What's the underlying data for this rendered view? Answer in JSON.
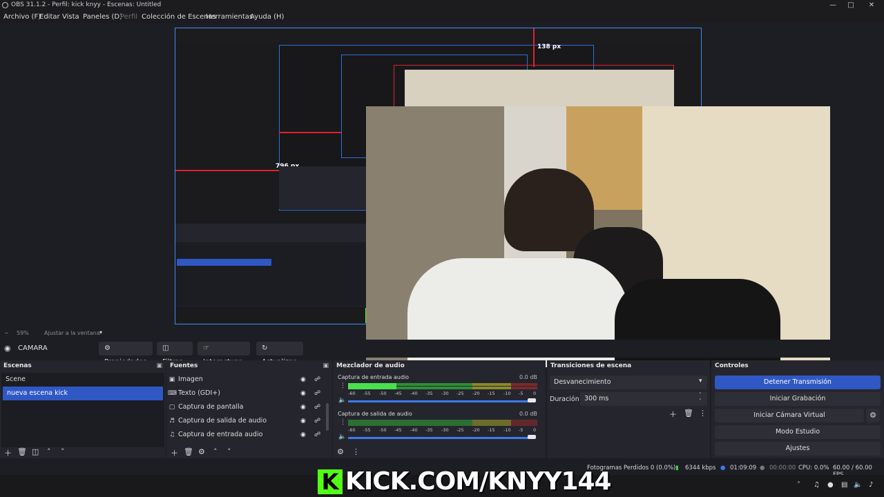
{
  "window": {
    "title": "OBS 31.1.2 - Perfil: kick knyy - Escenas: Untitled"
  },
  "menu": [
    "Archivo (F)",
    "Editar",
    "Vista",
    "Paneles (D)",
    "Perfil",
    "Colección de Escenas",
    "Herramientas",
    "Ayuda (H)"
  ],
  "preview": {
    "px_top": "138 px",
    "px_left": "796 px",
    "px_inner": "796 px"
  },
  "zoom": {
    "value": "59%",
    "fit": "Ajustar a la ventana"
  },
  "source_bar": {
    "name": "CAMARA",
    "props": "Propiedades",
    "filters": "Filtros",
    "interact": "Interactuar",
    "refresh": "Actualizar"
  },
  "scenes": {
    "title": "Escenas",
    "items": [
      "Scene",
      "nueva escena kick"
    ]
  },
  "sources": {
    "title": "Fuentes",
    "items": [
      "Imagen",
      "Texto (GDI+)",
      "Captura de pantalla",
      "Captura de salida de audio",
      "Captura de entrada audio"
    ]
  },
  "mixer": {
    "title": "Mezclador de audio",
    "channels": [
      {
        "name": "Captura de entrada audio",
        "db": "0.0 dB"
      },
      {
        "name": "Captura de salida de audio",
        "db": "0.0 dB"
      }
    ],
    "ticks": [
      "-60",
      "-55",
      "-50",
      "-45",
      "-40",
      "-35",
      "-30",
      "-25",
      "-20",
      "-15",
      "-10",
      "-5",
      "0"
    ]
  },
  "transitions": {
    "title": "Transiciones de escena",
    "selected": "Desvanecimiento",
    "duration_label": "Duración",
    "duration_value": "300 ms"
  },
  "controls": {
    "title": "Controles",
    "stop_stream": "Detener Transmisión",
    "start_record": "Iniciar Grabación",
    "virtual_cam": "Iniciar Cámara Virtual",
    "studio": "Modo Estudio",
    "settings": "Ajustes"
  },
  "status": {
    "dropped": "Fotogramas Perdidos 0 (0.0%)",
    "kbps": "6344 kbps",
    "live_time": "01:09:09",
    "rec_time": "00:00:00",
    "cpu": "CPU: 0.0%",
    "fps": "60.00 / 60.00 FPS"
  },
  "overlay": {
    "kick_text": "KICK.COM/KNYY144",
    "kick_letter": "K"
  },
  "colors": {
    "accent": "#2f58c4",
    "kick": "#53fc18",
    "red_guide": "#e0222e"
  }
}
